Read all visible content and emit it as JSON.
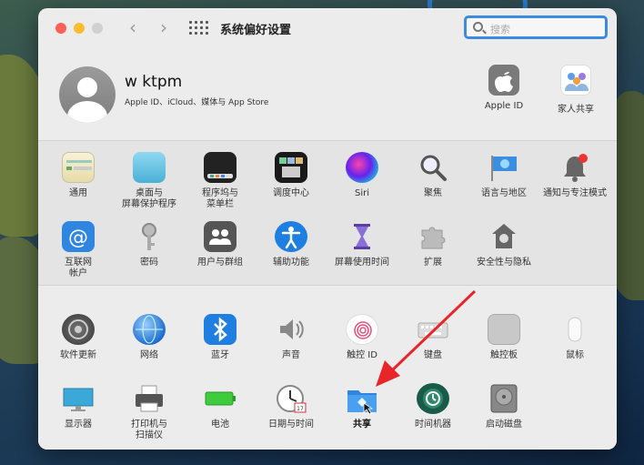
{
  "window": {
    "title": "系统偏好设置",
    "search_placeholder": "搜索"
  },
  "account": {
    "name": "w ktpm",
    "subtitle": "Apple ID、iCloud、媒体与 App Store"
  },
  "top_panes": [
    {
      "label": "Apple ID",
      "icon": "apple-id-icon"
    },
    {
      "label": "家人共享",
      "icon": "family-sharing-icon"
    }
  ],
  "panes_a": [
    {
      "label": "通用",
      "icon": "general-icon"
    },
    {
      "label": "桌面与\n屏幕保护程序",
      "icon": "desktop-screensaver-icon"
    },
    {
      "label": "程序坞与\n菜单栏",
      "icon": "dock-menubar-icon"
    },
    {
      "label": "调度中心",
      "icon": "mission-control-icon"
    },
    {
      "label": "Siri",
      "icon": "siri-icon"
    },
    {
      "label": "聚焦",
      "icon": "spotlight-icon"
    },
    {
      "label": "语言与地区",
      "icon": "language-region-icon"
    },
    {
      "label": "通知与专注模式",
      "icon": "notifications-icon"
    },
    {
      "label": "互联网\n帐户",
      "icon": "internet-accounts-icon"
    },
    {
      "label": "密码",
      "icon": "passwords-icon"
    },
    {
      "label": "用户与群组",
      "icon": "users-groups-icon"
    },
    {
      "label": "辅助功能",
      "icon": "accessibility-icon"
    },
    {
      "label": "屏幕使用时间",
      "icon": "screen-time-icon"
    },
    {
      "label": "扩展",
      "icon": "extensions-icon"
    },
    {
      "label": "安全性与隐私",
      "icon": "security-privacy-icon"
    }
  ],
  "panes_b": [
    {
      "label": "软件更新",
      "icon": "software-update-icon"
    },
    {
      "label": "网络",
      "icon": "network-icon"
    },
    {
      "label": "蓝牙",
      "icon": "bluetooth-icon"
    },
    {
      "label": "声音",
      "icon": "sound-icon"
    },
    {
      "label": "触控 ID",
      "icon": "touch-id-icon"
    },
    {
      "label": "键盘",
      "icon": "keyboard-icon"
    },
    {
      "label": "触控板",
      "icon": "trackpad-icon"
    },
    {
      "label": "鼠标",
      "icon": "mouse-icon"
    },
    {
      "label": "显示器",
      "icon": "displays-icon"
    },
    {
      "label": "打印机与\n扫描仪",
      "icon": "printers-scanners-icon"
    },
    {
      "label": "电池",
      "icon": "battery-icon"
    },
    {
      "label": "日期与时间",
      "icon": "date-time-icon"
    },
    {
      "label": "共享",
      "icon": "sharing-icon",
      "highlighted": true
    },
    {
      "label": "时间机器",
      "icon": "time-machine-icon"
    },
    {
      "label": "启动磁盘",
      "icon": "startup-disk-icon"
    }
  ],
  "colors": {
    "accent": "#3d8be0",
    "annotation_arrow": "#e8262a"
  }
}
